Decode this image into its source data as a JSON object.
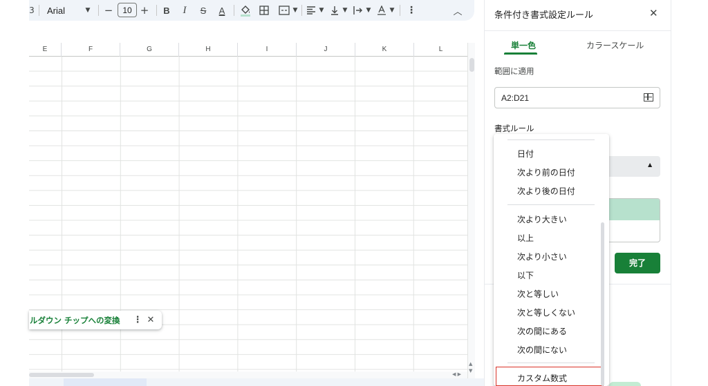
{
  "toolbar": {
    "partial_left": "3",
    "font_name": "Arial",
    "font_size": "10",
    "decrease_label": "−",
    "increase_label": "+",
    "bold_label": "B",
    "italic_label": "I",
    "strike_label": "S",
    "text_color_label": "A",
    "more_label": "⋮",
    "collapse_label": "︿",
    "icons": [
      "fill-color-icon",
      "borders-icon",
      "merge-cells-icon",
      "align-icon",
      "vertical-align-icon",
      "text-rotation-icon"
    ]
  },
  "sheet": {
    "columns": [
      "E",
      "F",
      "G",
      "H",
      "I",
      "J",
      "K",
      "L"
    ]
  },
  "chip_popup": {
    "text": "ルダウン チップへの変換",
    "more": "⋮",
    "close": "✕"
  },
  "panel": {
    "title": "条件付き書式設定ルール",
    "close": "✕",
    "tabs": [
      "単一色",
      "カラースケール"
    ],
    "active_tab": "単一色",
    "range_label": "範囲に適用",
    "range_value": "A2:D21",
    "rule_label": "書式ルール",
    "done_button": "完了",
    "preview_fill_color": "#b7e1cd",
    "accent_color": "#188038"
  },
  "menu": {
    "items": [
      {
        "label": "日付"
      },
      {
        "label": "次より前の日付"
      },
      {
        "label": "次より後の日付"
      },
      {
        "label": "次より大きい"
      },
      {
        "label": "以上"
      },
      {
        "label": "次より小さい"
      },
      {
        "label": "以下"
      },
      {
        "label": "次と等しい"
      },
      {
        "label": "次と等しくない"
      },
      {
        "label": "次の間にある"
      },
      {
        "label": "次の間にない"
      },
      {
        "label": "カスタム数式"
      }
    ],
    "highlighted": "カスタム数式",
    "highlight_color": "#d93025"
  }
}
